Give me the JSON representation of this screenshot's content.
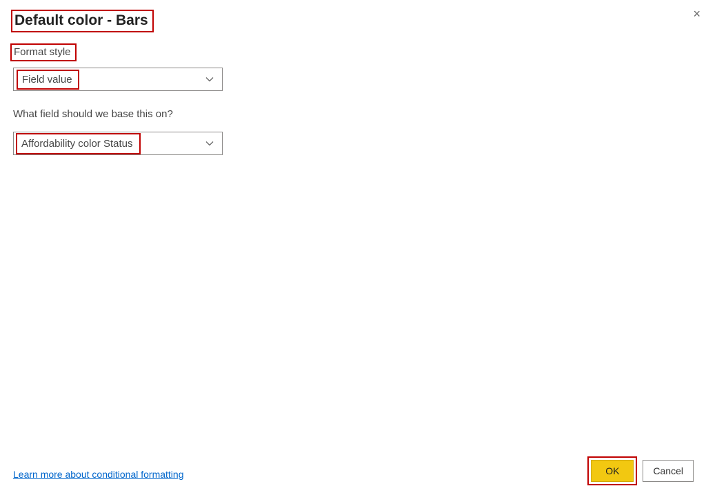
{
  "dialog": {
    "title": "Default color - Bars",
    "close_icon": "×"
  },
  "format_style": {
    "label": "Format style",
    "selected": "Field value"
  },
  "field_base": {
    "label": "What field should we base this on?",
    "selected": "Affordability color Status"
  },
  "footer": {
    "learn_more": "Learn more about conditional formatting",
    "ok": "OK",
    "cancel": "Cancel"
  }
}
